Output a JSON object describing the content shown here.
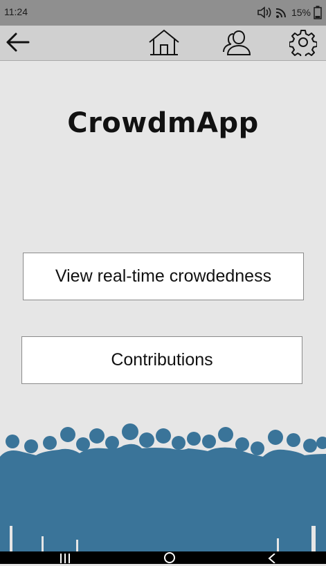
{
  "status": {
    "time": "11:24",
    "battery": "15%",
    "icons": [
      "volume-icon",
      "wifi-icon",
      "battery-icon"
    ]
  },
  "toolbar": {
    "icons": [
      "back-arrow-icon",
      "home-icon",
      "profile-icon",
      "settings-icon"
    ]
  },
  "app": {
    "title": "CrowdmApp"
  },
  "buttons": {
    "realtime": "View real-time crowdedness",
    "contributions": "Contributions"
  },
  "colors": {
    "background": "#e6e6e6",
    "crowd": "#3a7499",
    "toolbar": "#d0d0d0",
    "statusbar": "#8f8f8f"
  },
  "navbar": {
    "icons": [
      "recent-apps-icon",
      "home-circle-icon",
      "nav-back-icon"
    ]
  }
}
